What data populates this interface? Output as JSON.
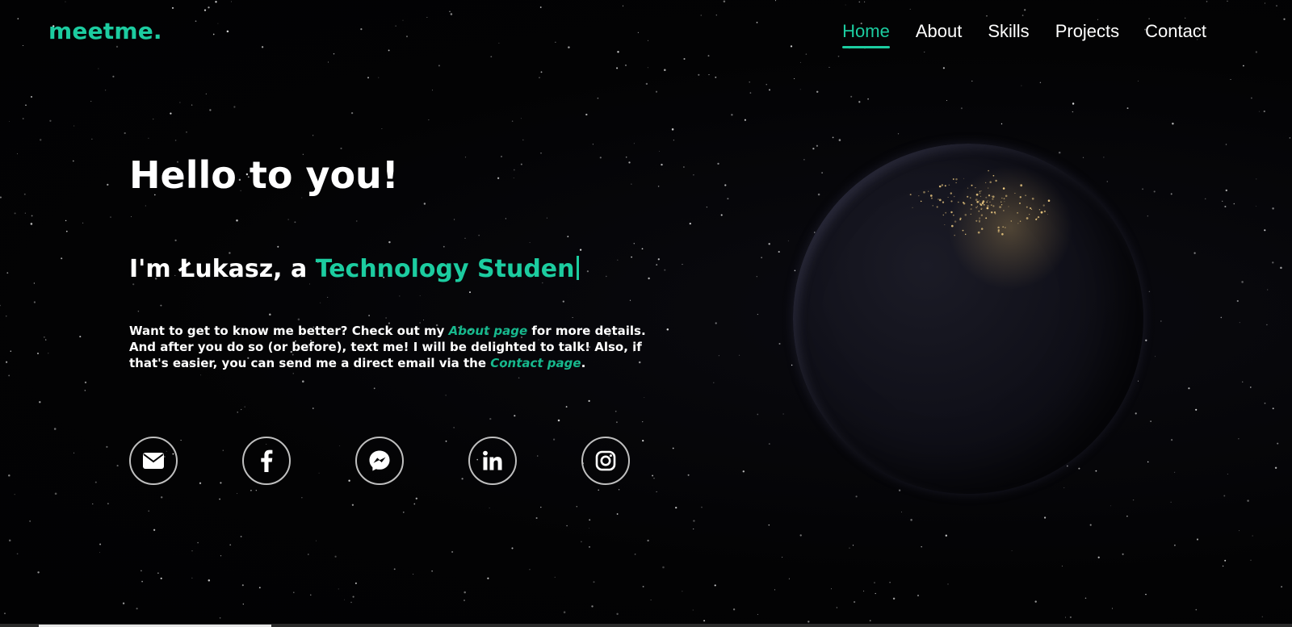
{
  "colors": {
    "accent": "#1ccca0",
    "link": "#17b88d",
    "text": "#ffffff",
    "background": "#030304"
  },
  "brand": {
    "logo": "meetme."
  },
  "nav": {
    "items": [
      {
        "label": "Home",
        "active": true
      },
      {
        "label": "About",
        "active": false
      },
      {
        "label": "Skills",
        "active": false
      },
      {
        "label": "Projects",
        "active": false
      },
      {
        "label": "Contact",
        "active": false
      }
    ]
  },
  "hero": {
    "title": "Hello to you!",
    "intro_prefix": "I'm Łukasz, a ",
    "intro_highlight": "Technology Studen",
    "description": {
      "part1": "Want to get to know me better? Check out my ",
      "about_link": "About page",
      "part2": " for more details. And after you do so (or before), text me! I will be delighted to talk! Also, if that's easier, you can send me a direct email via the ",
      "contact_link": "Contact page",
      "part3": "."
    }
  },
  "socials": [
    {
      "icon": "envelope-icon",
      "name": "email-button"
    },
    {
      "icon": "facebook-icon",
      "name": "facebook-button"
    },
    {
      "icon": "messenger-icon",
      "name": "messenger-button"
    },
    {
      "icon": "linkedin-icon",
      "name": "linkedin-button"
    },
    {
      "icon": "instagram-icon",
      "name": "instagram-button"
    }
  ],
  "scroll_progress": 0.18
}
